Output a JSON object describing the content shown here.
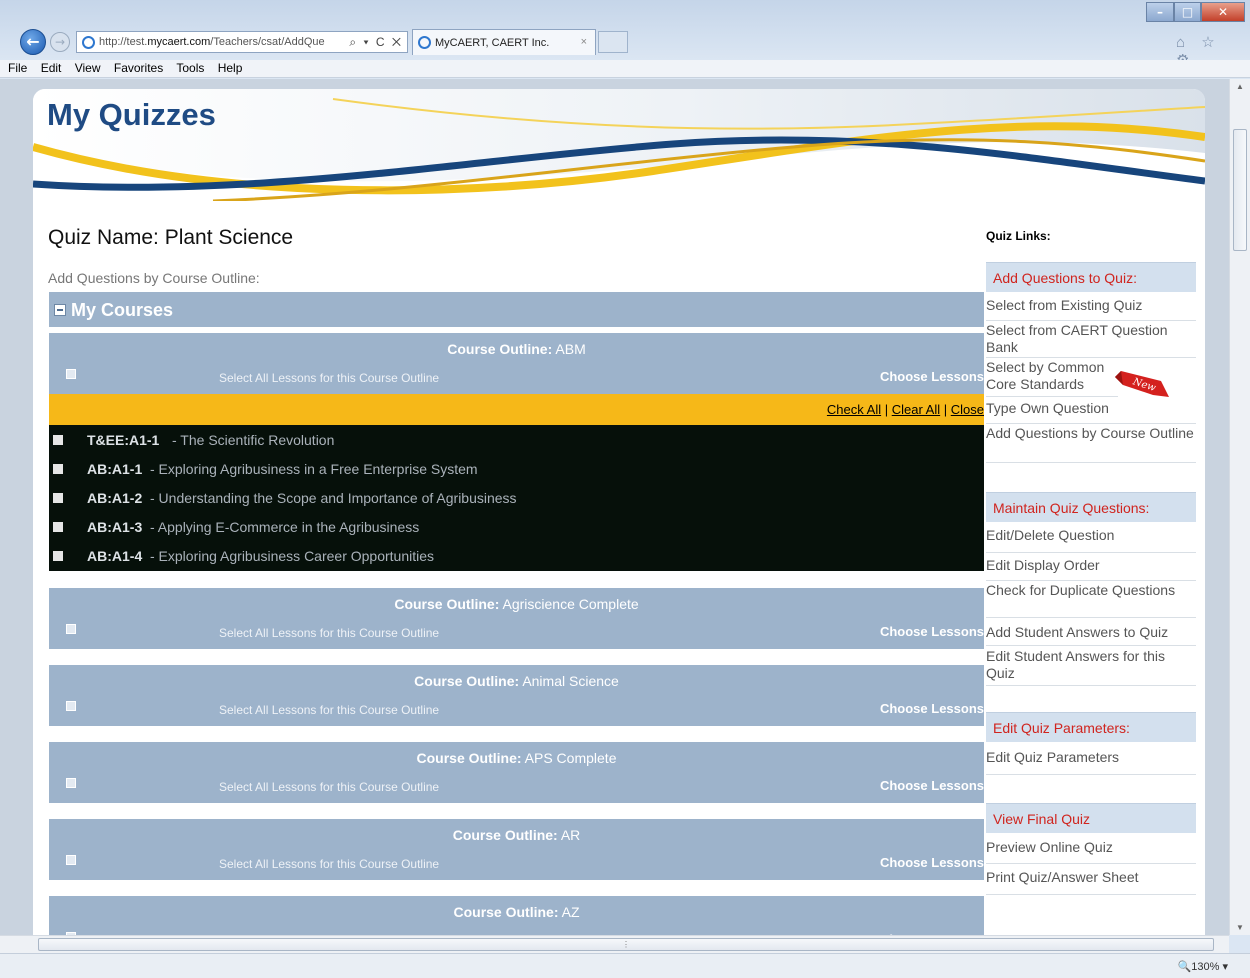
{
  "browser": {
    "url_prefix": "http://test.",
    "url_domain": "mycaert.com",
    "url_rest": "/Teachers/csat/AddQue",
    "url_controls": "⌕ ▾ C ✕",
    "tab_title": "MyCAERT, CAERT Inc.",
    "tab_close": "×",
    "menu": [
      "File",
      "Edit",
      "View",
      "Favorites",
      "Tools",
      "Help"
    ],
    "toolbar_icons": "⌂ ☆ ⚙",
    "zoom": "🔍130%",
    "zoom_arrow": "▾"
  },
  "page": {
    "title": "My Quizzes",
    "quiz_name": "Quiz Name: Plant Science",
    "subtitle": "Add Questions by Course Outline:",
    "my_courses": "My Courses",
    "course_label": "Course Outline:",
    "select_all": "Select All Lessons for this Course Outline",
    "choose_lessons": "Choose Lessons",
    "check_all": "Check All",
    "clear_all": "Clear All",
    "close": "Close",
    "separator": " | ",
    "courses": [
      {
        "name": "ABM"
      },
      {
        "name": "Agriscience Complete"
      },
      {
        "name": "Animal Science"
      },
      {
        "name": "APS Complete"
      },
      {
        "name": "AR"
      },
      {
        "name": "AZ"
      }
    ],
    "lessons": [
      {
        "code": "T&EE:A1-1",
        "title": " - The Scientific Revolution"
      },
      {
        "code": "AB:A1-1",
        "title": " - Exploring Agribusiness in a Free Enterprise System"
      },
      {
        "code": "AB:A1-2",
        "title": " - Understanding the Scope and Importance of Agribusiness"
      },
      {
        "code": "AB:A1-3",
        "title": " - Applying E-Commerce in the Agribusiness"
      },
      {
        "code": "AB:A1-4",
        "title": " - Exploring Agribusiness Career Opportunities"
      }
    ]
  },
  "sidebar": {
    "heading": "Quiz Links:",
    "new_badge": "New",
    "sections": [
      {
        "title": "Add Questions to Quiz:",
        "links": [
          "Select from Existing Quiz",
          "Select from CAERT Question Bank",
          "Select by Common Core Standards",
          "Type Own Question",
          "Add Questions by Course Outline"
        ]
      },
      {
        "title": "Maintain Quiz Questions:",
        "links": [
          "Edit/Delete Question",
          "Edit Display Order",
          "Check for Duplicate Questions",
          "Add Student Answers to Quiz",
          "Edit Student Answers for this Quiz"
        ]
      },
      {
        "title": "Edit Quiz Parameters:",
        "links": [
          "Edit Quiz Parameters"
        ]
      },
      {
        "title": "View Final Quiz",
        "links": [
          "Preview Online Quiz",
          "Print Quiz/Answer Sheet"
        ]
      }
    ]
  },
  "colors": {
    "title_blue": "#1f4b84",
    "section_red": "#d0241e",
    "course_bar": "#9db3cb",
    "open_bar": "#f6b818",
    "lessons_bg": "#06100a"
  }
}
